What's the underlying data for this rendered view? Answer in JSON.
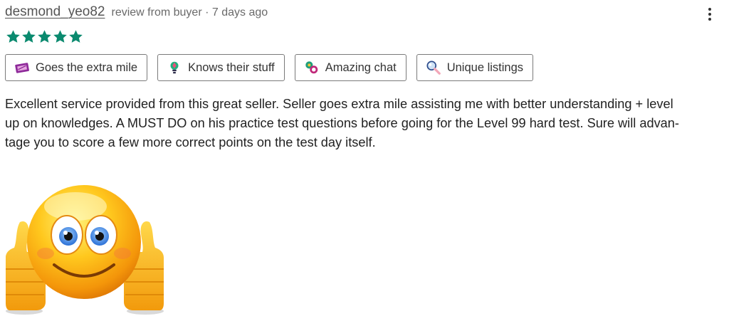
{
  "review": {
    "username": "desmond_yeo82",
    "meta": "review from buyer · 7 days ago",
    "rating": 5,
    "star_color": "#0b8a6f",
    "star_icon": "star-icon",
    "menu_icon": "kebab-menu-icon",
    "tags": [
      {
        "label": "Goes the extra mile",
        "icon": "ticket-icon"
      },
      {
        "label": "Knows their stuff",
        "icon": "lightbulb-icon"
      },
      {
        "label": "Amazing chat",
        "icon": "chat-icon"
      },
      {
        "label": "Unique listings",
        "icon": "magnifier-icon"
      }
    ],
    "body_lines": [
      "Excellent service provided from this great seller. Seller goes extra mile assisting me with better understanding + level",
      "up on knowledges. A MUST DO on his practice test questions before going for the Level 99 hard test. Sure will advan-",
      "tage you to score a few more correct points on the test day itself."
    ],
    "image": "thumbs-up-smiley-emoji"
  }
}
